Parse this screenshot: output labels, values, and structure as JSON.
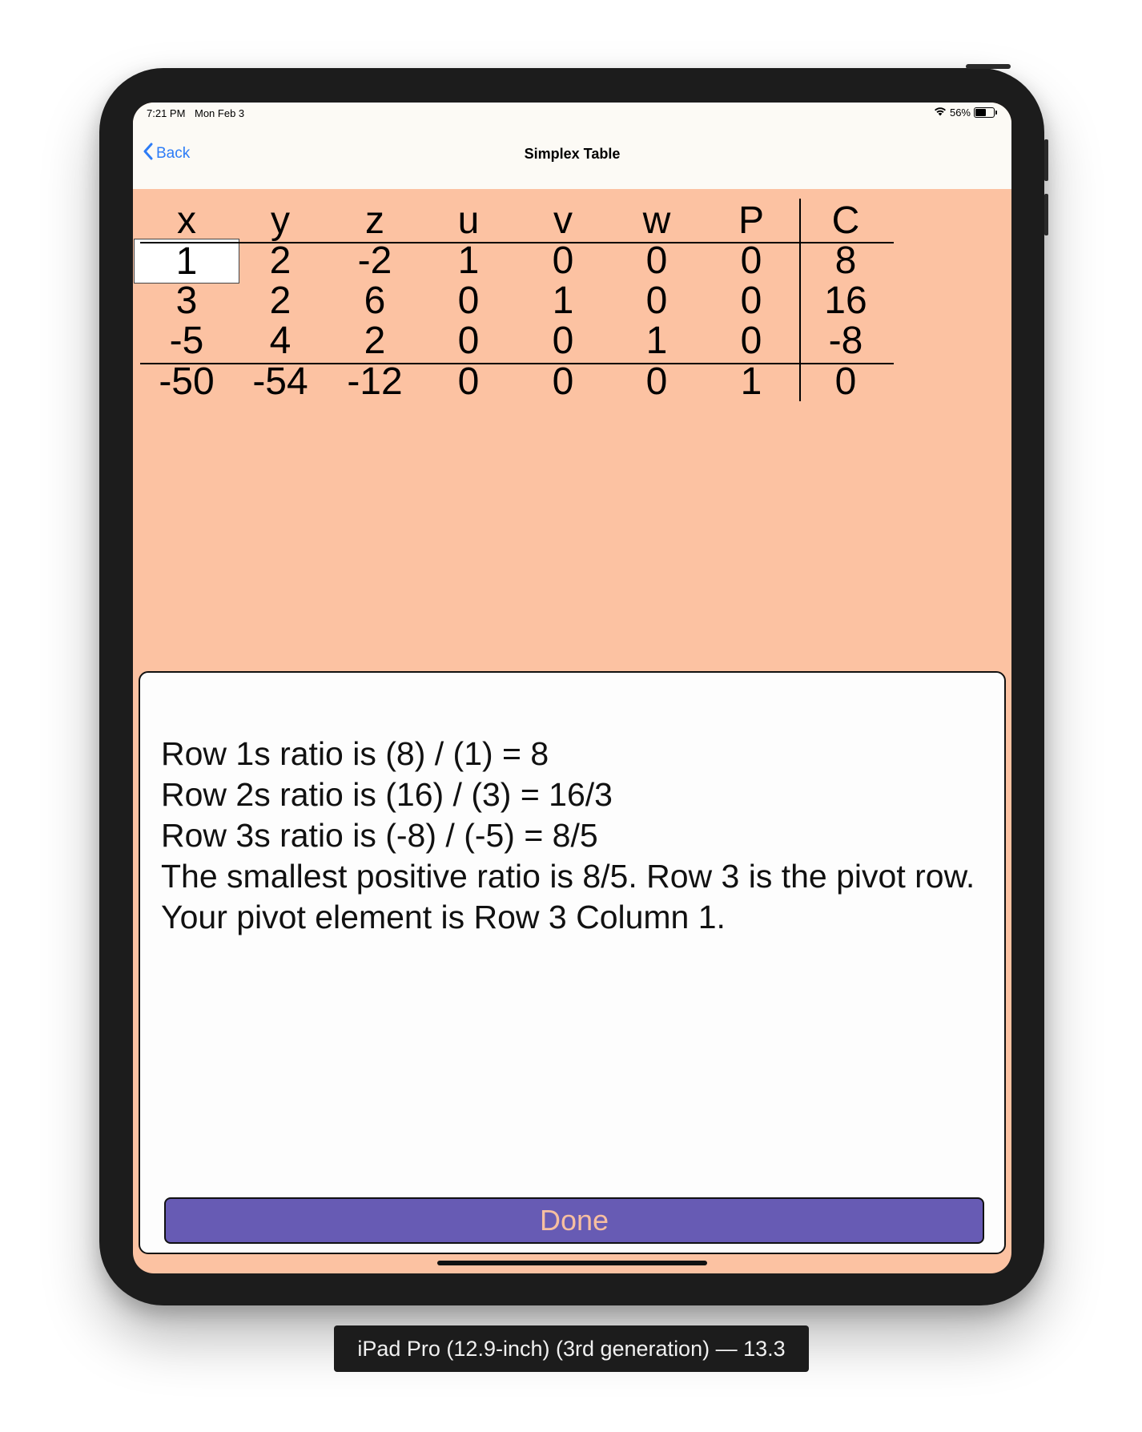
{
  "status": {
    "time": "7:21 PM",
    "date": "Mon Feb 3",
    "battery": "56%",
    "battery_level": 0.56
  },
  "nav": {
    "back_label": "Back",
    "title": "Simplex Table"
  },
  "tableau": {
    "headers": [
      "x",
      "y",
      "z",
      "u",
      "v",
      "w",
      "P",
      "C"
    ],
    "rows": [
      [
        "1",
        "2",
        "-2",
        "1",
        "0",
        "0",
        "0",
        "8"
      ],
      [
        "3",
        "2",
        "6",
        "0",
        "1",
        "0",
        "0",
        "16"
      ],
      [
        "-5",
        "4",
        "2",
        "0",
        "0",
        "1",
        "0",
        "-8"
      ],
      [
        "-50",
        "-54",
        "-12",
        "0",
        "0",
        "0",
        "1",
        "0"
      ]
    ]
  },
  "explanation": {
    "lines": [
      "Row 1s ratio is (8) / (1) = 8",
      "Row 2s ratio is (16) / (3) = 16/3",
      "Row 3s ratio is (-8) / (-5) = 8/5",
      "The smallest positive ratio is 8/5.  Row 3 is the pivot row.",
      "Your pivot element is Row 3 Column 1."
    ]
  },
  "done_label": "Done",
  "device_label": "iPad Pro (12.9-inch) (3rd generation) — 13.3"
}
